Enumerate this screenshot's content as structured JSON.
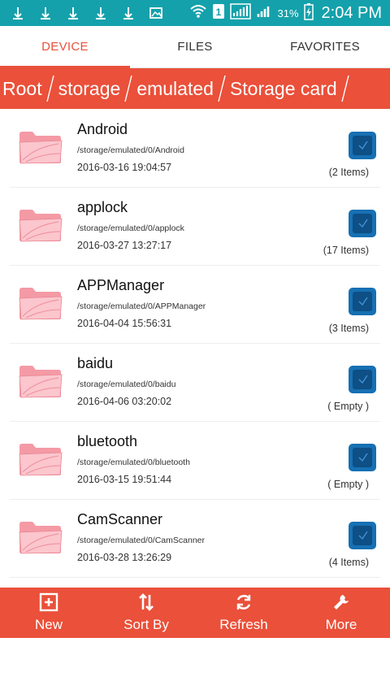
{
  "status_bar": {
    "battery": "31%",
    "time": "2:04 PM",
    "icons": [
      "usb-icon",
      "usb-icon",
      "usb-icon",
      "usb-icon",
      "usb-icon",
      "image-icon",
      "wifi-icon",
      "sim1-icon",
      "signal-icon",
      "signal-icon",
      "battery-charging-icon"
    ]
  },
  "tabs": [
    {
      "label": "DEVICE",
      "active": true
    },
    {
      "label": "FILES",
      "active": false
    },
    {
      "label": "FAVORITES",
      "active": false
    }
  ],
  "breadcrumb": [
    "Root",
    "storage",
    "emulated",
    "Storage card"
  ],
  "files": [
    {
      "name": "Android",
      "path": "/storage/emulated/0/Android",
      "date": "2016-03-16 19:04:57",
      "count": "(2 Items)"
    },
    {
      "name": "applock",
      "path": "/storage/emulated/0/applock",
      "date": "2016-03-27 13:27:17",
      "count": "(17 Items)"
    },
    {
      "name": "APPManager",
      "path": "/storage/emulated/0/APPManager",
      "date": "2016-04-04 15:56:31",
      "count": "(3 Items)"
    },
    {
      "name": "baidu",
      "path": "/storage/emulated/0/baidu",
      "date": "2016-04-06 03:20:02",
      "count": "( Empty )"
    },
    {
      "name": "bluetooth",
      "path": "/storage/emulated/0/bluetooth",
      "date": "2016-03-15 19:51:44",
      "count": "( Empty )"
    },
    {
      "name": "CamScanner",
      "path": "/storage/emulated/0/CamScanner",
      "date": "2016-03-28 13:26:29",
      "count": "(4 Items)"
    }
  ],
  "toolbar": {
    "new_label": "New",
    "sort_label": "Sort By",
    "refresh_label": "Refresh",
    "more_label": "More"
  },
  "colors": {
    "status_bar": "#14a1ab",
    "accent": "#ea503a",
    "checkbox": "#1670b3"
  }
}
